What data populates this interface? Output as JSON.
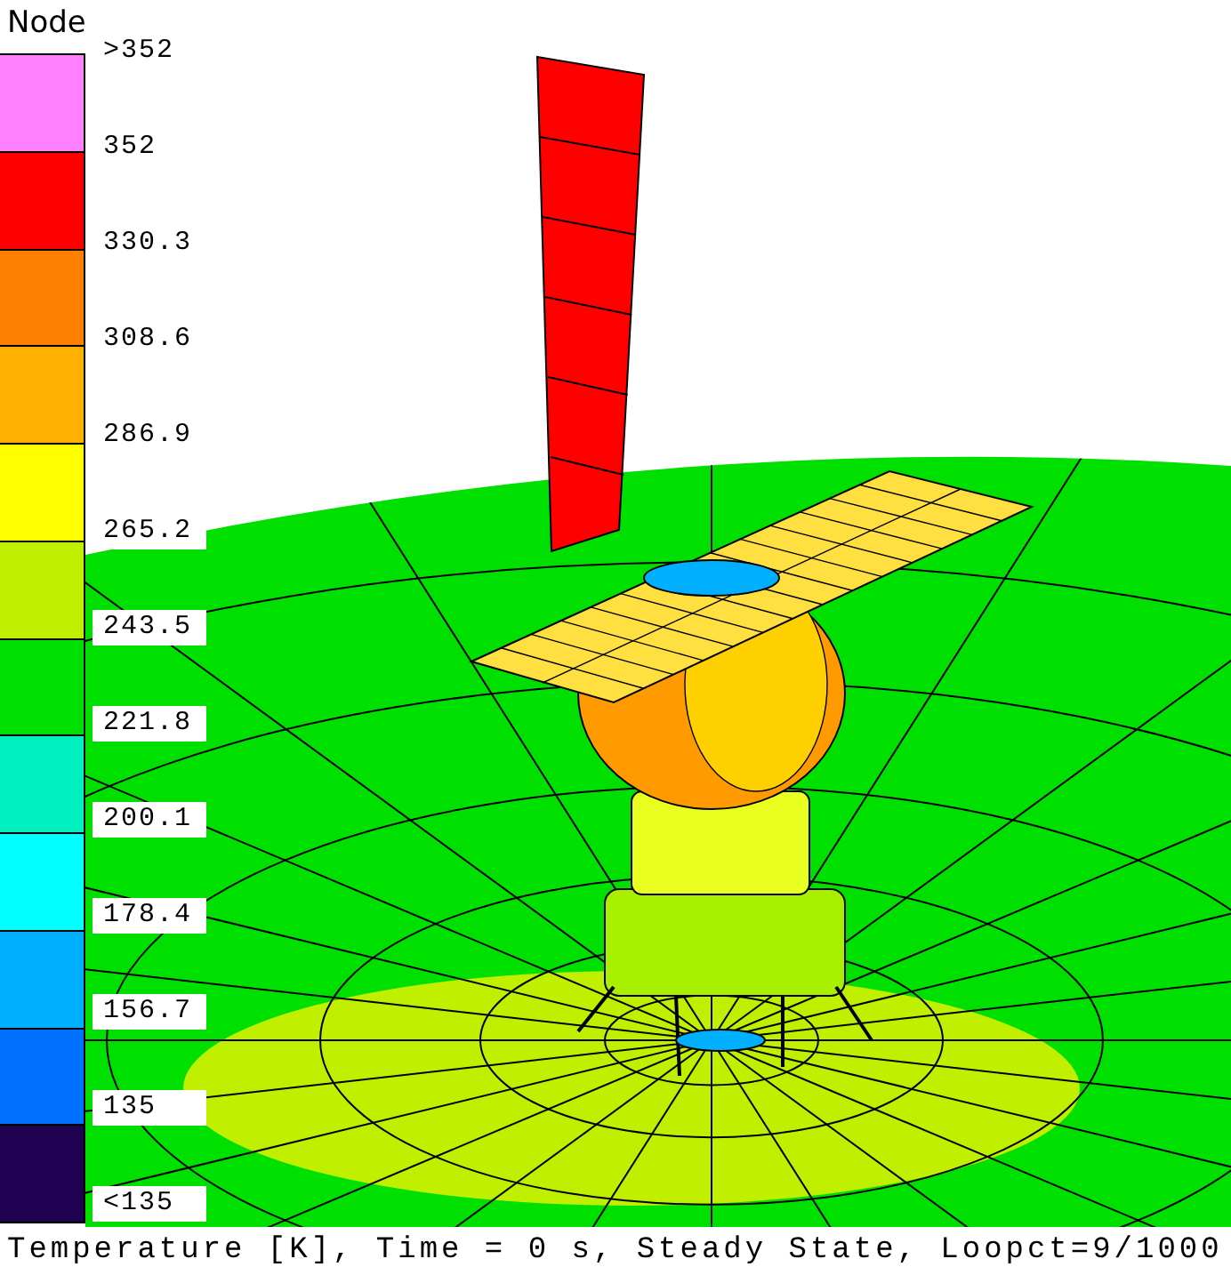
{
  "legend": {
    "title": "Node",
    "bands": [
      {
        "color": "#ff80ff"
      },
      {
        "color": "#ff0000"
      },
      {
        "color": "#ff8000"
      },
      {
        "color": "#ffb000"
      },
      {
        "color": "#ffff00"
      },
      {
        "color": "#c0f000"
      },
      {
        "color": "#00e000"
      },
      {
        "color": "#00f0c0"
      },
      {
        "color": "#00ffff"
      },
      {
        "color": "#00b0ff"
      },
      {
        "color": "#0070ff"
      },
      {
        "color": "#200050"
      }
    ],
    "labels": [
      ">352",
      "352",
      "330.3",
      "308.6",
      "286.9",
      "265.2",
      "243.5",
      "221.8",
      "200.1",
      "178.4",
      "156.7",
      "135",
      "<135"
    ]
  },
  "status_bar": "Temperature [K], Time = 0 s, Steady State, Loopct=9/1000"
}
